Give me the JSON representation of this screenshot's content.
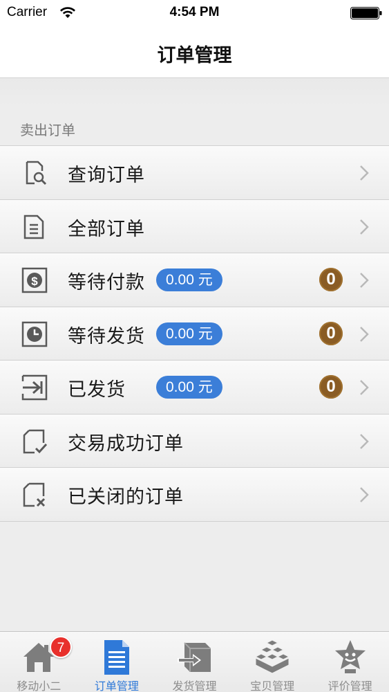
{
  "status_bar": {
    "carrier": "Carrier",
    "time": "4:54 PM"
  },
  "nav": {
    "title": "订单管理"
  },
  "section": {
    "header": "卖出订单"
  },
  "rows": [
    {
      "label": "查询订单",
      "icon": "search-document-icon"
    },
    {
      "label": "全部订单",
      "icon": "document-list-icon"
    },
    {
      "label": "等待付款",
      "icon": "money-icon",
      "amount": "0.00 元",
      "count": "0"
    },
    {
      "label": "等待发货",
      "icon": "clock-icon",
      "amount": "0.00 元",
      "count": "0"
    },
    {
      "label": "已发货",
      "icon": "shipped-arrow-icon",
      "amount": "0.00 元",
      "count": "0"
    },
    {
      "label": "交易成功订单",
      "icon": "document-check-icon"
    },
    {
      "label": "已关闭的订单",
      "icon": "document-close-icon"
    }
  ],
  "tabs": [
    {
      "label": "移动小二",
      "icon": "home-icon",
      "badge": "7"
    },
    {
      "label": "订单管理",
      "icon": "order-document-icon",
      "active": true
    },
    {
      "label": "发货管理",
      "icon": "shipping-icon"
    },
    {
      "label": "宝贝管理",
      "icon": "boxes-icon"
    },
    {
      "label": "评价管理",
      "icon": "star-face-icon"
    }
  ],
  "colors": {
    "accent": "#2f79d8",
    "pill": "#3b7ed8",
    "count_badge": "#8a5c24",
    "tab_badge": "#e8302c"
  }
}
